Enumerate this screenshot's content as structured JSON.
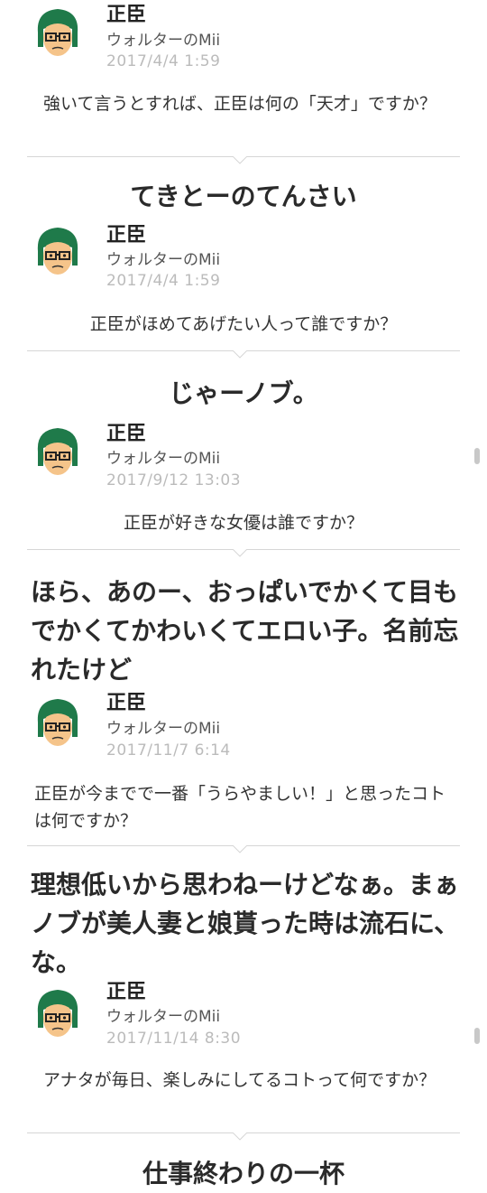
{
  "posts": [
    {
      "name": "正臣",
      "owner": "ウォルターのMii",
      "date": "2017/4/4  1:59",
      "question": "強いて言うとすれば、正臣は何の「天才」ですか？",
      "answer": "てきとーのてんさい"
    },
    {
      "name": "正臣",
      "owner": "ウォルターのMii",
      "date": "2017/4/4  1:59",
      "question": "正臣がほめてあげたい人って誰ですか？",
      "answer": "じゃーノブ。"
    },
    {
      "name": "正臣",
      "owner": "ウォルターのMii",
      "date": "2017/9/12  13:03",
      "question": "正臣が好きな女優は誰ですか？",
      "answer": "ほら、あのー、おっぱいでかくて目もでかくてかわいくてエロい子。名前忘れたけど"
    },
    {
      "name": "正臣",
      "owner": "ウォルターのMii",
      "date": "2017/11/7  6:14",
      "question": "正臣が今までで一番「うらやましい！」と思ったコトは何ですか？",
      "answer": "理想低いから思わねーけどなぁ。まぁノブが美人妻と娘貰った時は流石に、な。"
    },
    {
      "name": "正臣",
      "owner": "ウォルターのMii",
      "date": "2017/11/14  8:30",
      "question": "アナタが毎日、楽しみにしてるコトって何ですか？",
      "answer": "仕事終わりの一杯"
    }
  ],
  "colors": {
    "hair": "#1f7a4a",
    "skin": "#f5c48a",
    "divider": "#d6d6d6",
    "date": "#bbbbbb"
  }
}
